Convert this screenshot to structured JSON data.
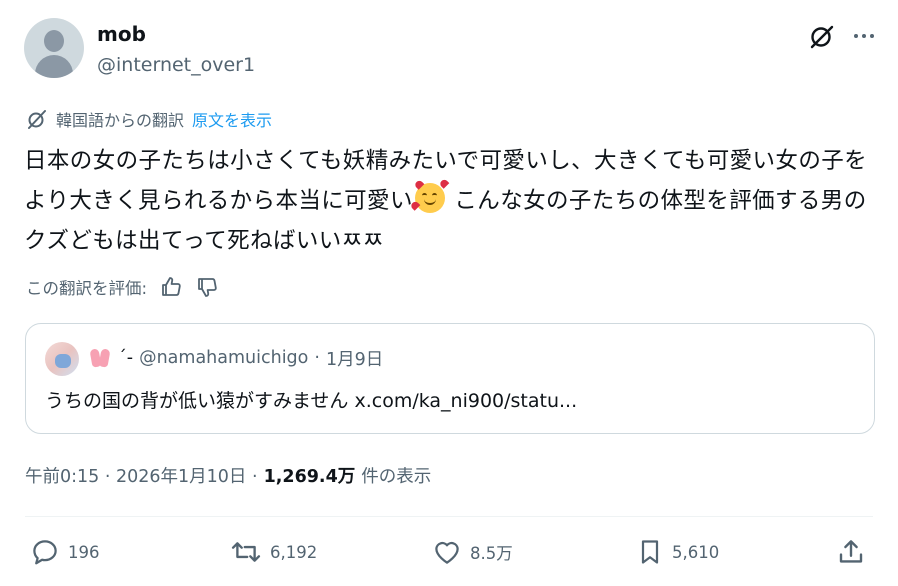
{
  "author": {
    "name": "mob",
    "handle": "@internet_over1"
  },
  "icons": {
    "grok": "grok-icon",
    "more": "more-icon",
    "translate": "translate-icon",
    "thumbs_up": "thumbs-up-icon",
    "thumbs_down": "thumbs-down-icon",
    "reply": "reply-icon",
    "retweet": "retweet-icon",
    "like": "like-icon",
    "bookmark": "bookmark-icon",
    "share": "share-icon",
    "emoji": "smiling-face-with-hearts-emoji"
  },
  "translation": {
    "label": "韓国語からの翻訳",
    "show_original": "原文を表示",
    "rate_label": "この翻訳を評価:"
  },
  "tweet": {
    "text_part1": "日本の女の子たちは小さくても妖精みたいで可愛いし、大きくても可愛い女の子をより大きく見られるから本当に可愛い",
    "text_part2": " こんな女の子たちの体型を評価する男のクズどもは出てって死ねばいいㅉㅉ"
  },
  "quote": {
    "display_name": "´-",
    "handle": "@namahamuichigo",
    "separator": "·",
    "date": "1月9日",
    "text": "うちの国の背が低い猿がすみません x.com/ka_ni900/statu..."
  },
  "meta": {
    "time": "午前0:15 · 2026年1月10日 ·",
    "views_count": "1,269.4万",
    "views_label": "件の表示"
  },
  "actions": {
    "replies": "196",
    "retweets": "6,192",
    "likes": "8.5万",
    "bookmarks": "5,610"
  },
  "colors": {
    "text": "#0f1419",
    "secondary": "#536471",
    "link": "#1d9bf0",
    "border": "#cfd9de"
  }
}
